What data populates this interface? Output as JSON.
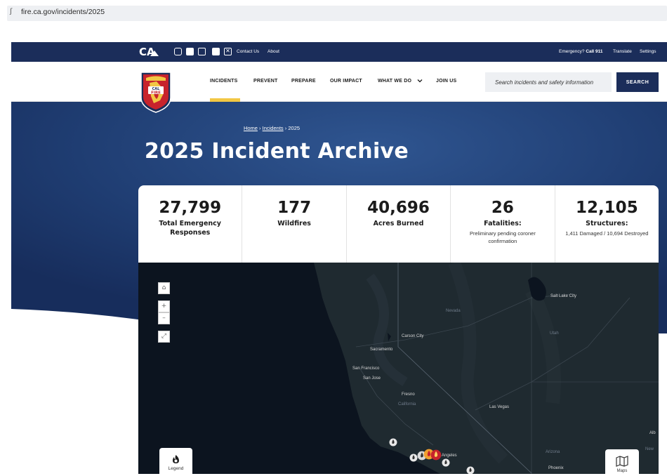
{
  "browser": {
    "url_glyph": "ʃ",
    "url": "fire.ca.gov/incidents/2025"
  },
  "utility": {
    "links": [
      "Contact Us",
      "About"
    ],
    "emergency_prefix": "Emergency?",
    "emergency_call": "Call 911",
    "translate": "Translate",
    "settings": "Settings",
    "bar_color": "#1b2d5a"
  },
  "nav": {
    "items": [
      {
        "label": "INCIDENTS",
        "active": true
      },
      {
        "label": "PREVENT"
      },
      {
        "label": "PREPARE"
      },
      {
        "label": "OUR IMPACT"
      },
      {
        "label": "WHAT WE DO"
      },
      {
        "label": "JOIN US"
      }
    ],
    "search_placeholder": "Search incidents and safety information",
    "search_button": "SEARCH",
    "active_bar_color": "#f2c744"
  },
  "logo": {
    "cal": "CAL",
    "fire": "FIRE"
  },
  "hero": {
    "breadcrumb": {
      "home": "Home",
      "incidents": "Incidents",
      "current": "2025",
      "separator": "›"
    },
    "title": "2025 Incident Archive"
  },
  "stats": [
    {
      "value": "27,799",
      "label": "Total Emergency Responses",
      "sub": ""
    },
    {
      "value": "177",
      "label": "Wildfires",
      "sub": ""
    },
    {
      "value": "40,696",
      "label": "Acres Burned",
      "sub": ""
    },
    {
      "value": "26",
      "label": "Fatalities:",
      "sub": "Preliminary pending coroner confirmation"
    },
    {
      "value": "12,105",
      "label": "Structures:",
      "sub": "1,411 Damaged / 10,694 Destroyed"
    }
  ],
  "map": {
    "labels": {
      "salt_lake_city": "Salt Lake City",
      "nevada": "Nevada",
      "carson_city": "Carson City",
      "utah": "Utah",
      "sacramento": "Sacramento",
      "san_francisco": "San Francisco",
      "san_jose": "San Jose",
      "fresno": "Fresno",
      "california": "California",
      "las_vegas": "Las Vegas",
      "albuquerque_partial": "Alb",
      "new_partial": "New",
      "angeles_partial": "Angeles",
      "arizona": "Arizona",
      "phoenix": "Phoenix"
    },
    "controls": {
      "home": "⌂",
      "zoom_in": "+",
      "zoom_out": "–",
      "fullscreen": "⤢"
    },
    "legend_label": "Legend",
    "maps_label": "Maps"
  }
}
